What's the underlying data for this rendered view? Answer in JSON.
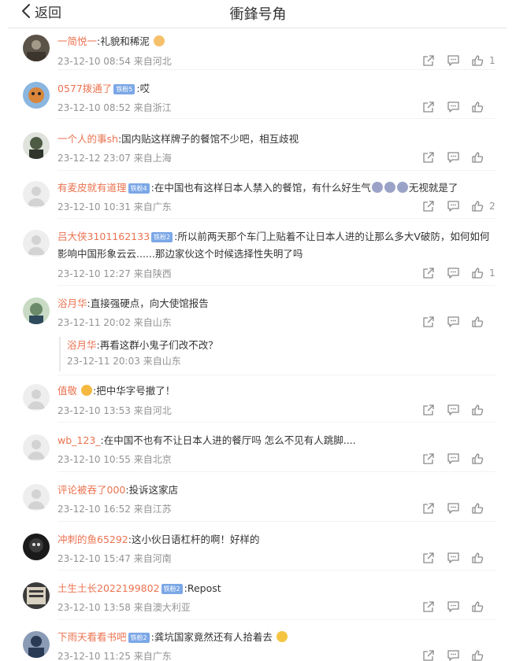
{
  "header": {
    "back_label": "返回",
    "title": "衝鋒号角"
  },
  "comments": [
    {
      "user": "一简悦一",
      "badge": "",
      "text": ":礼貌和稀泥",
      "time": "23-12-10 08:54",
      "location": "来自河北",
      "likes": "1",
      "avatar_color": "#5b5248"
    },
    {
      "user": "0577拨通了",
      "badge": "铁粉5",
      "text": ":哎",
      "time": "23-12-10 08:52",
      "location": "来自浙江",
      "likes": "",
      "avatar_color": "#d9863b"
    },
    {
      "user": "一个人的事sh",
      "badge": "",
      "text": ":国内贴这样牌子的餐馆不少吧，相互歧视",
      "time": "23-12-12 23:07",
      "location": "来自上海",
      "likes": "",
      "avatar_color": "#4d5a44"
    },
    {
      "user": "有麦皮就有道理",
      "badge": "铁粉4",
      "text": ":在中国也有这样日本人禁入的餐馆，有什么好生气",
      "text_after": "无视就是了",
      "time": "23-12-10 10:31",
      "location": "来自广东",
      "likes": "2",
      "avatar_color": "#e6e6e6"
    },
    {
      "user": "吕大侠3101162133",
      "badge": "铁粉2",
      "text": ":所以前两天那个车门上贴着不让日本人进的让那么多大V破防，如何如何影响中国形象云云......那边家伙这个时候选择性失明了吗",
      "time": "23-12-10 12:27",
      "location": "来自陕西",
      "likes": "1",
      "avatar_color": "#e6e6e6"
    },
    {
      "user": "浴月华",
      "badge": "",
      "text": ":直接强硬点，向大使馆报告",
      "time": "23-12-11 20:02",
      "location": "来自山东",
      "likes": "",
      "avatar_color": "#6b8a6a",
      "reply": {
        "user": "浴月华",
        "text": ":再看这群小鬼子们改不改？",
        "time": "23-12-11 20:03",
        "location": "来自山东"
      }
    },
    {
      "user": "值敬",
      "badge": "",
      "text": ":把中华字号撤了！",
      "time": "23-12-10 13:53",
      "location": "来自河北",
      "likes": "",
      "avatar_color": "#e6e6e6"
    },
    {
      "user": "wb_123_",
      "badge": "",
      "text": ":在中国不也有不让日本人进的餐厅吗 怎么不见有人跳脚....",
      "time": "23-12-10 10:55",
      "location": "来自北京",
      "likes": "",
      "avatar_color": "#e6e6e6"
    },
    {
      "user": "评论被吞了000",
      "badge": "",
      "text": ":投诉这家店",
      "time": "23-12-10 16:52",
      "location": "来自江苏",
      "likes": "",
      "avatar_color": "#e6e6e6"
    },
    {
      "user": "冲刺的鱼65292",
      "badge": "",
      "text": ":这小伙日语杠杆的啊！好样的",
      "time": "23-12-10 15:47",
      "location": "来自河南",
      "likes": "",
      "avatar_color": "#1a1a1a"
    },
    {
      "user": "土生土长2022199802",
      "badge": "铁粉2",
      "text": ":Repost",
      "time": "23-12-10 13:58",
      "location": "来自澳大利亚",
      "likes": "",
      "avatar_color": "#3a3a3a"
    },
    {
      "user": "下雨天看看书吧",
      "badge": "铁粉2",
      "text": ":龚坑国家竟然还有人拾着去",
      "time": "23-12-10 11:25",
      "location": "来自广东",
      "likes": "",
      "avatar_color": "#2a3a55"
    }
  ]
}
